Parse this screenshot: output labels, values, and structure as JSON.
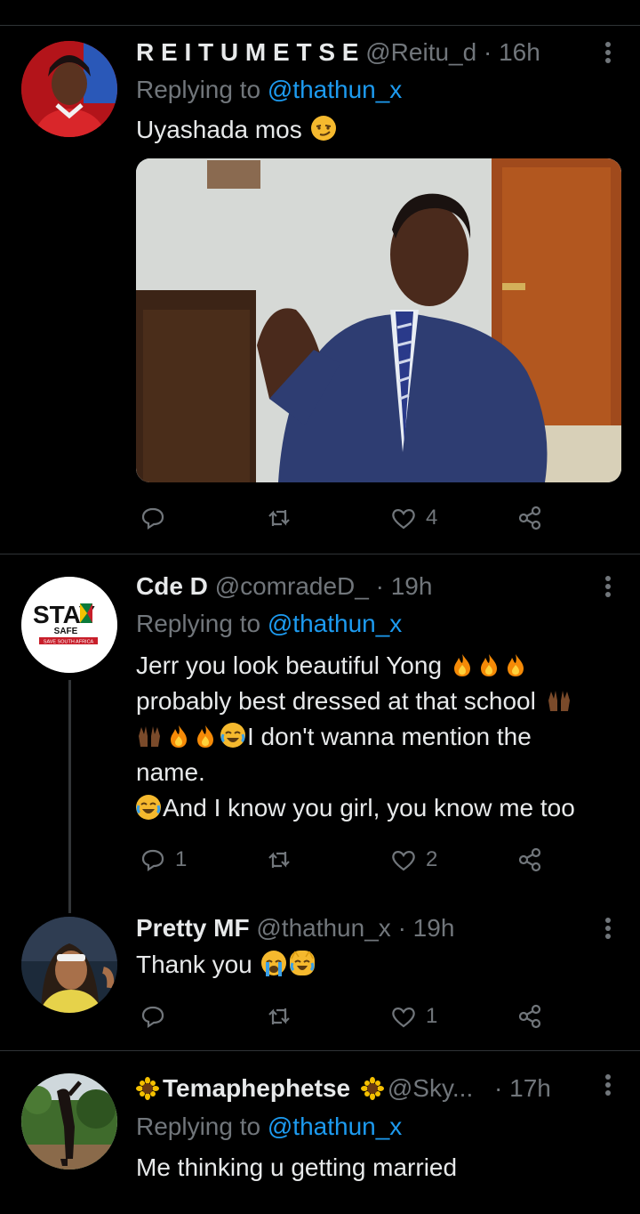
{
  "tweets": [
    {
      "name": "R E I T U M E T S E",
      "handle": "@Reitu_d",
      "dot": "·",
      "time": "16h",
      "reply_prefix": "Replying to",
      "reply_to": "@thathun_x",
      "lines": [
        "Uyashada mos"
      ],
      "media_alt": "photo-of-man-in-suit",
      "reply_count": "",
      "like_count": "4"
    },
    {
      "name": "Cde D",
      "handle": "@comradeD_",
      "dot": "·",
      "time": "19h",
      "reply_prefix": "Replying to",
      "reply_to": "@thathun_x",
      "avatar_text": "STAY",
      "avatar_sub": "SAFE",
      "avatar_tag": "SAVE SOUTH AFRICA",
      "lines": [
        "Jerr you look beautiful Yong",
        "probably best dressed at that school",
        "I don't wanna mention the",
        "name.",
        "And I know you girl, you know me too"
      ],
      "reply_count": "1",
      "like_count": "2"
    },
    {
      "name": "Pretty MF",
      "handle": "@thathun_x",
      "dot": "·",
      "time": "19h",
      "lines": [
        "Thank you"
      ],
      "reply_count": "",
      "like_count": "1"
    },
    {
      "name": "Temaphephetse",
      "handle": "@Sky...",
      "dot": "·",
      "time": "17h",
      "reply_prefix": "Replying to",
      "reply_to": "@thathun_x",
      "lines": [
        "Me thinking u getting married"
      ]
    }
  ],
  "icons": {
    "more": "more-icon",
    "reply": "reply-icon",
    "retweet": "retweet-icon",
    "like": "like-icon",
    "share": "share-icon"
  },
  "colors": {
    "background": "#000000",
    "text": "#e7e9ea",
    "muted": "#71767b",
    "accent": "#1d9bf0",
    "separator": "#2f3336"
  }
}
